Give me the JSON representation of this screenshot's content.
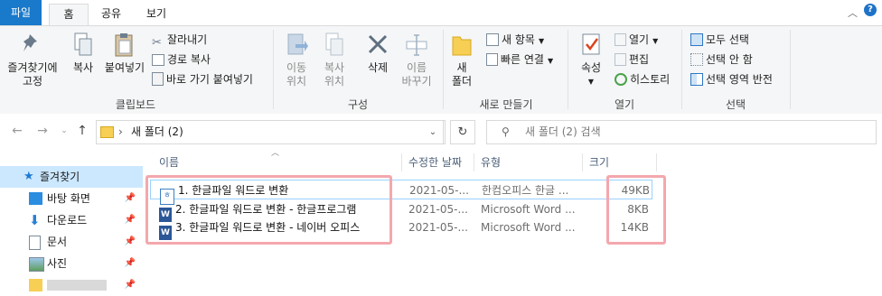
{
  "tabs": {
    "file": "파일",
    "home": "홈",
    "share": "공유",
    "view": "보기"
  },
  "ribbon": {
    "clipboard": {
      "pin": "즐겨찾기에\n고정",
      "copy": "복사",
      "paste": "붙여넣기",
      "cut": "잘라내기",
      "copy_path": "경로 복사",
      "paste_shortcut": "바로 가기 붙여넣기",
      "label": "클립보드"
    },
    "organize": {
      "move_to": "이동\n위치",
      "copy_to": "복사\n위치",
      "delete": "삭제",
      "rename": "이름\n바꾸기",
      "label": "구성"
    },
    "new": {
      "new_folder": "새\n폴더",
      "new_item": "새 항목",
      "easy_access": "빠른 연결",
      "label": "새로 만들기"
    },
    "open": {
      "properties": "속성",
      "open": "열기",
      "edit": "편집",
      "history": "히스토리",
      "label": "열기"
    },
    "select": {
      "select_all": "모두 선택",
      "select_none": "선택 안 함",
      "invert": "선택 영역 반전",
      "label": "선택"
    }
  },
  "address": {
    "path": "새 폴더 (2)",
    "search_placeholder": "새 폴더 (2) 검색"
  },
  "nav": {
    "quick_access": "즐겨찾기",
    "items": [
      {
        "label": "바탕 화면",
        "icon": "desktop-icon"
      },
      {
        "label": "다운로드",
        "icon": "download-icon"
      },
      {
        "label": "문서",
        "icon": "documents-icon"
      },
      {
        "label": "사진",
        "icon": "pictures-icon"
      }
    ]
  },
  "columns": {
    "name": "이름",
    "date": "수정한 날짜",
    "type": "유형",
    "size": "크기"
  },
  "files": [
    {
      "name": "1. 한글파일 워드로 변환",
      "date": "2021-05-...",
      "type": "한컴오피스 한글 ...",
      "size": "49KB",
      "icon": "hwp-file-icon"
    },
    {
      "name": "2. 한글파일 워드로 변환 - 한글프로그램",
      "date": "2021-05-...",
      "type": "Microsoft Word ...",
      "size": "8KB",
      "icon": "word-file-icon"
    },
    {
      "name": "3. 한글파일 워드로 변환 - 네이버 오피스",
      "date": "2021-05-...",
      "type": "Microsoft Word ...",
      "size": "14KB",
      "icon": "word-file-icon"
    }
  ],
  "colors": {
    "accent": "#1979ca",
    "highlight": "#f4a7ad",
    "selected_row": "#cce8ff"
  }
}
